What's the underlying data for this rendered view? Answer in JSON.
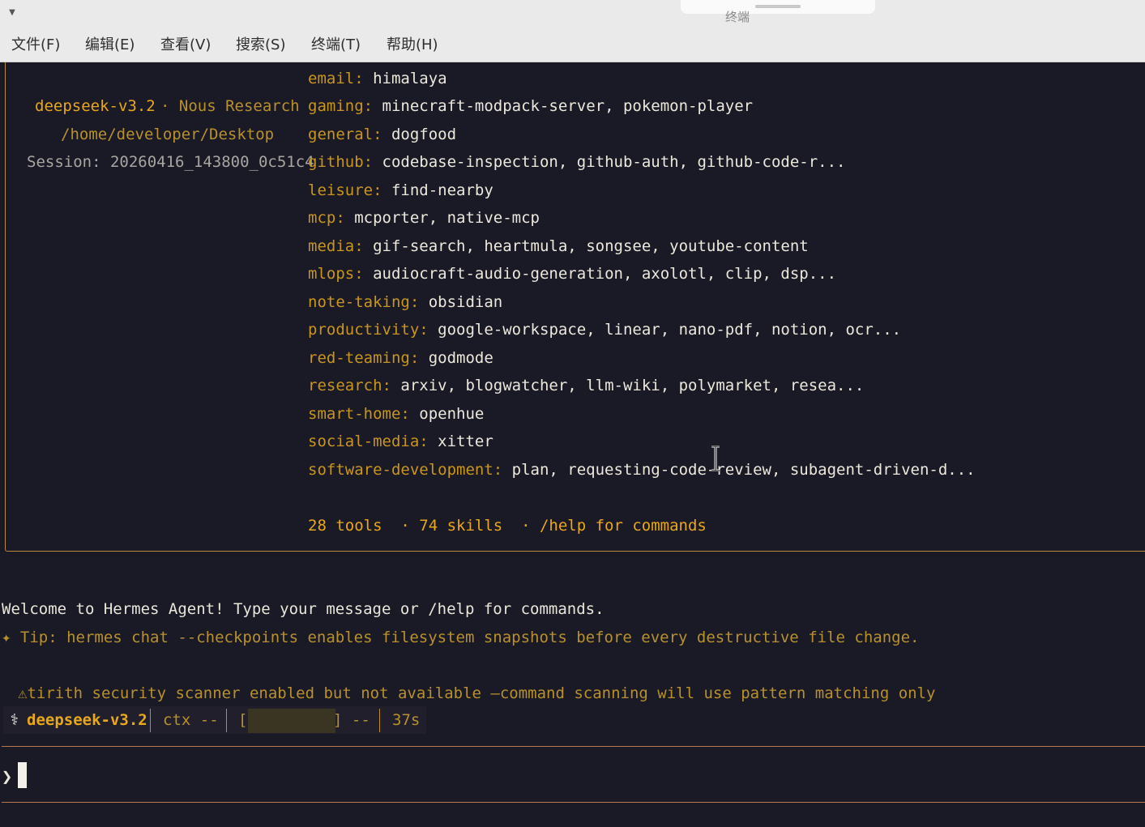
{
  "window": {
    "title": "终端",
    "menu": [
      "文件(F)",
      "编辑(E)",
      "查看(V)",
      "搜索(S)",
      "终端(T)",
      "帮助(H)"
    ]
  },
  "banner": {
    "model": "deepseek-v3.2",
    "provider": "· Nous Research",
    "cwd": "/home/developer/Desktop",
    "session": "Session: 20260416_143800_0c51c4",
    "skills": [
      {
        "category": "email:",
        "items": "himalaya"
      },
      {
        "category": "gaming:",
        "items": "minecraft-modpack-server, pokemon-player"
      },
      {
        "category": "general:",
        "items": "dogfood"
      },
      {
        "category": "github:",
        "items": "codebase-inspection, github-auth, github-code-r..."
      },
      {
        "category": "leisure:",
        "items": "find-nearby"
      },
      {
        "category": "mcp:",
        "items": "mcporter, native-mcp"
      },
      {
        "category": "media:",
        "items": "gif-search, heartmula, songsee, youtube-content"
      },
      {
        "category": "mlops:",
        "items": "audiocraft-audio-generation, axolotl, clip, dsp..."
      },
      {
        "category": "note-taking:",
        "items": "obsidian"
      },
      {
        "category": "productivity:",
        "items": "google-workspace, linear, nano-pdf, notion, ocr..."
      },
      {
        "category": "red-teaming:",
        "items": "godmode"
      },
      {
        "category": "research:",
        "items": "arxiv, blogwatcher, llm-wiki, polymarket, resea..."
      },
      {
        "category": "smart-home:",
        "items": "openhue"
      },
      {
        "category": "social-media:",
        "items": "xitter"
      },
      {
        "category": "software-development:",
        "items": "plan, requesting-code-review, subagent-driven-d..."
      }
    ],
    "summary": "28 tools  · 74 skills  · /help for commands"
  },
  "messages": {
    "welcome": "Welcome to Hermes Agent! Type your message or /help for commands.",
    "tip": "✦ Tip: hermes chat --checkpoints enables filesystem snapshots before every destructive file change.",
    "warning": "⚠tirith security scanner enabled but not available —command scanning will use pattern matching only"
  },
  "status_bar": {
    "icon": "⚕",
    "model": "deepseek-v3.2",
    "ctx": "ctx --",
    "meter_open": "[",
    "meter_close": "] --",
    "elapsed": "37s"
  },
  "prompt": {
    "symbol": "❯",
    "input": ""
  },
  "colors": {
    "background": "#1a1926",
    "accent_gold": "#e9a81a",
    "border": "#b88a3a",
    "text": "#e9e6da"
  }
}
